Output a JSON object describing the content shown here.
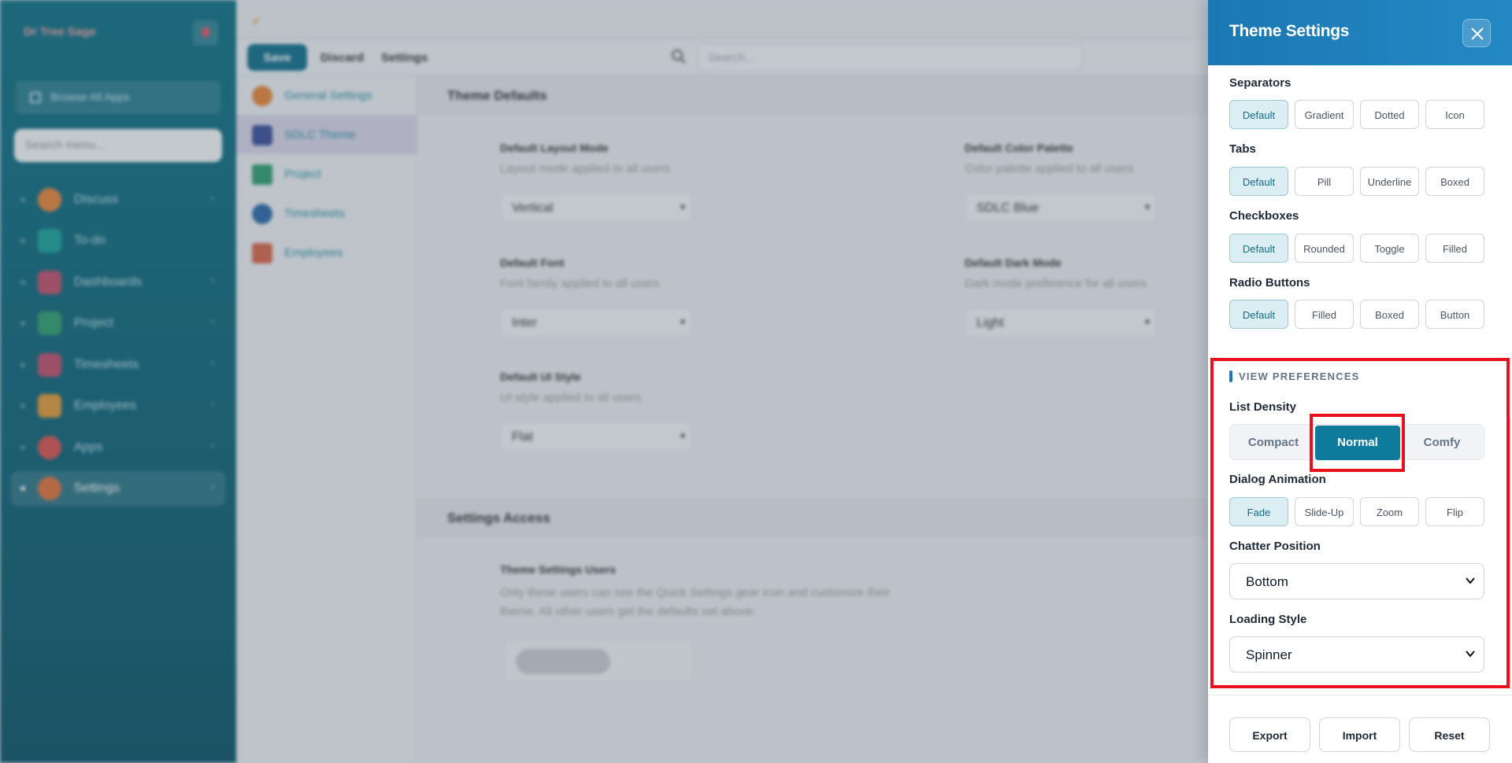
{
  "sidebar": {
    "brand": "Dr Tree Sage",
    "browse_all": "Browse All Apps",
    "search_placeholder": "Search menu...",
    "items": [
      {
        "label": "Discuss",
        "icon": "discuss-icon",
        "color": "#e8853a"
      },
      {
        "label": "To-do",
        "icon": "todo-icon",
        "color": "#1aa39a"
      },
      {
        "label": "Dashboards",
        "icon": "dashboards-icon",
        "color": "#c0506a"
      },
      {
        "label": "Project",
        "icon": "project-icon",
        "color": "#2f9e6e"
      },
      {
        "label": "Timesheets",
        "icon": "timesheets-icon",
        "color": "#c0506a"
      },
      {
        "label": "Employees",
        "icon": "employees-icon",
        "color": "#e29b3a"
      },
      {
        "label": "Apps",
        "icon": "apps-icon",
        "color": "#d9534f"
      },
      {
        "label": "Settings",
        "icon": "settings-icon",
        "color": "#e0733a"
      }
    ]
  },
  "toolbar": {
    "save": "Save",
    "discard": "Discard",
    "settings": "Settings",
    "search_placeholder": "Search..."
  },
  "subnav": [
    {
      "label": "General Settings",
      "color": "#e8853a"
    },
    {
      "label": "SDLC Theme",
      "color": "#3b4f9a"
    },
    {
      "label": "Project",
      "color": "#2f9e6e"
    },
    {
      "label": "Timesheets",
      "color": "#2b6aa8"
    },
    {
      "label": "Employees",
      "color": "#d9674a"
    }
  ],
  "content": {
    "theme_defaults": {
      "heading": "Theme Defaults",
      "layout_mode": {
        "label": "Default Layout Mode",
        "desc": "Layout mode applied to all users",
        "value": "Vertical"
      },
      "color_palette": {
        "label": "Default Color Palette",
        "desc": "Color palette applied to all users",
        "value": "SDLC Blue"
      },
      "font": {
        "label": "Default Font",
        "desc": "Font family applied to all users",
        "value": "Inter"
      },
      "dark_mode": {
        "label": "Default Dark Mode",
        "desc": "Dark mode preference for all users",
        "value": "Light"
      },
      "ui_style": {
        "label": "Default UI Style",
        "desc": "UI style applied to all users",
        "value": "Flat"
      }
    },
    "settings_access": {
      "heading": "Settings Access",
      "users_label": "Theme Settings Users",
      "users_desc": "Only these users can see the Quick Settings gear icon and customize their theme. All other users get the defaults set above."
    }
  },
  "drawer": {
    "title": "Theme Settings",
    "separators": {
      "label": "Separators",
      "options": [
        "Default",
        "Gradient",
        "Dotted",
        "Icon"
      ],
      "selected": "Default"
    },
    "tabs": {
      "label": "Tabs",
      "options": [
        "Default",
        "Pill",
        "Underline",
        "Boxed"
      ],
      "selected": "Default"
    },
    "checkboxes": {
      "label": "Checkboxes",
      "options": [
        "Default",
        "Rounded",
        "Toggle",
        "Filled"
      ],
      "selected": "Default"
    },
    "radio_buttons": {
      "label": "Radio Buttons",
      "options": [
        "Default",
        "Filled",
        "Boxed",
        "Button"
      ],
      "selected": "Default"
    },
    "view_preferences": {
      "title": "VIEW PREFERENCES",
      "list_density": {
        "label": "List Density",
        "options": [
          "Compact",
          "Normal",
          "Comfy"
        ],
        "selected": "Normal"
      },
      "dialog_animation": {
        "label": "Dialog Animation",
        "options": [
          "Fade",
          "Slide-Up",
          "Zoom",
          "Flip"
        ],
        "selected": "Fade"
      },
      "chatter_position": {
        "label": "Chatter Position",
        "value": "Bottom"
      },
      "loading_style": {
        "label": "Loading Style",
        "value": "Spinner"
      }
    },
    "footer": {
      "export": "Export",
      "import": "Import",
      "reset": "Reset"
    }
  },
  "colors": {
    "accent": "#0f7b9c",
    "header_blue": "#1b78b2",
    "highlight_red": "#e8111c",
    "sidebar_teal": "#0f7185"
  }
}
